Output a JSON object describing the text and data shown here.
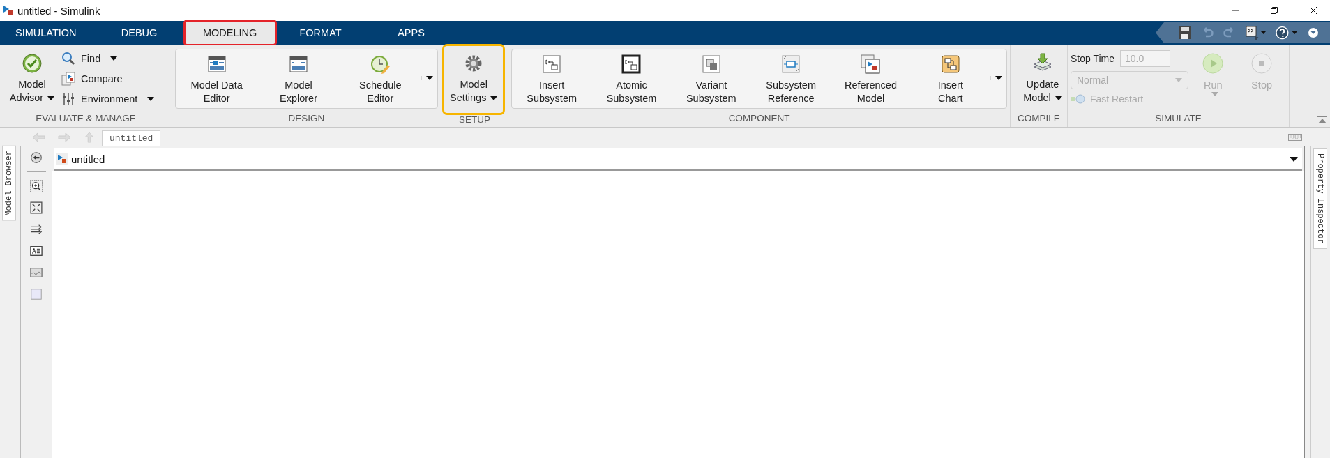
{
  "window": {
    "title": "untitled - Simulink"
  },
  "tabs": [
    {
      "label": "SIMULATION",
      "selected": false,
      "annotated": false
    },
    {
      "label": "DEBUG",
      "selected": false,
      "annotated": false
    },
    {
      "label": "MODELING",
      "selected": true,
      "annotated": true
    },
    {
      "label": "FORMAT",
      "selected": false,
      "annotated": false
    },
    {
      "label": "APPS",
      "selected": false,
      "annotated": false
    }
  ],
  "ribbon": {
    "sections": [
      {
        "kind": "plain",
        "title": "EVALUATE & MANAGE",
        "large_buttons": [
          {
            "lines": [
              "Model",
              "Advisor"
            ],
            "dropdown": true,
            "annotated": false
          }
        ],
        "small_buttons": [
          {
            "label": "Find",
            "dropdown": true
          },
          {
            "label": "Compare",
            "dropdown": false
          },
          {
            "label": "Environment",
            "dropdown": true
          }
        ]
      },
      {
        "kind": "gallery",
        "title": "DESIGN",
        "large_buttons": [
          {
            "lines": [
              "Model Data",
              "Editor"
            ],
            "dropdown": false,
            "annotated": false
          },
          {
            "lines": [
              "Model",
              "Explorer"
            ],
            "dropdown": false,
            "annotated": false
          },
          {
            "lines": [
              "Schedule",
              "Editor"
            ],
            "dropdown": false,
            "annotated": false
          }
        ]
      },
      {
        "kind": "plain",
        "title": "SETUP",
        "large_buttons": [
          {
            "lines": [
              "Model",
              "Settings"
            ],
            "dropdown": true,
            "annotated": true
          }
        ]
      },
      {
        "kind": "gallery",
        "title": "COMPONENT",
        "large_buttons": [
          {
            "lines": [
              "Insert",
              "Subsystem"
            ],
            "dropdown": false,
            "annotated": false
          },
          {
            "lines": [
              "Atomic",
              "Subsystem"
            ],
            "dropdown": false,
            "annotated": false
          },
          {
            "lines": [
              "Variant",
              "Subsystem"
            ],
            "dropdown": false,
            "annotated": false
          },
          {
            "lines": [
              "Subsystem",
              "Reference"
            ],
            "dropdown": false,
            "annotated": false
          },
          {
            "lines": [
              "Referenced",
              "Model"
            ],
            "dropdown": false,
            "annotated": false
          },
          {
            "lines": [
              "Insert",
              "Chart"
            ],
            "dropdown": false,
            "annotated": false
          }
        ]
      },
      {
        "kind": "plain",
        "title": "COMPILE",
        "large_buttons": [
          {
            "lines": [
              "Update",
              "Model"
            ],
            "dropdown": true,
            "annotated": false
          }
        ]
      },
      {
        "kind": "simulate",
        "title": "SIMULATE",
        "stop_time": {
          "label": "Stop Time",
          "value": "10.0",
          "disabled": true
        },
        "mode": {
          "value": "Normal",
          "disabled": true
        },
        "fast_restart": {
          "label": "Fast Restart",
          "disabled": true
        },
        "run": {
          "label": "Run",
          "dropdown": true,
          "disabled": true
        },
        "stop": {
          "label": "Stop",
          "disabled": true
        }
      }
    ]
  },
  "editor": {
    "doc_tab": {
      "label": "untitled",
      "selected": true
    },
    "address": "untitled",
    "left_panel": "Model Browser",
    "right_panel": "Property Inspector"
  }
}
